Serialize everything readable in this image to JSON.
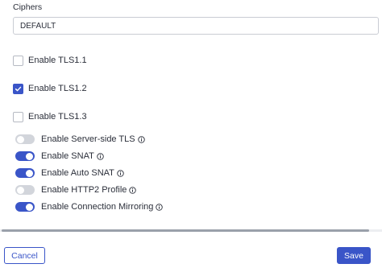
{
  "ciphers": {
    "label": "Ciphers",
    "value": "DEFAULT"
  },
  "tls_options": [
    {
      "label": "Enable TLS1.1",
      "checked": false
    },
    {
      "label": "Enable TLS1.2",
      "checked": true
    },
    {
      "label": "Enable TLS1.3",
      "checked": false
    }
  ],
  "toggles": [
    {
      "label": "Enable Server-side TLS",
      "on": false
    },
    {
      "label": "Enable SNAT",
      "on": true
    },
    {
      "label": "Enable Auto SNAT",
      "on": true
    },
    {
      "label": "Enable HTTP2 Profile",
      "on": false
    },
    {
      "label": "Enable Connection Mirroring",
      "on": true
    }
  ],
  "buttons": {
    "cancel_label": "Cancel",
    "save_label": "Save"
  },
  "colors": {
    "accent": "#3a55c8",
    "toggle_off": "#d2d5db",
    "text": "#2b2f3a"
  },
  "icons": {
    "info": "info-circle-icon",
    "check": "checkmark-icon"
  }
}
